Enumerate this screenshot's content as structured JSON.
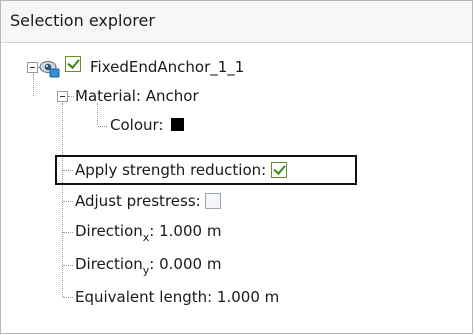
{
  "panel": {
    "title": "Selection explorer"
  },
  "tree": {
    "root": {
      "label": "FixedEndAnchor_1_1",
      "visible": true,
      "checked": true
    },
    "material": {
      "label": "Material: Anchor"
    },
    "colour": {
      "label": "Colour:",
      "value_hex": "#000000"
    },
    "apply_strength_reduction": {
      "label": "Apply strength reduction:",
      "checked": true
    },
    "adjust_prestress": {
      "label": "Adjust prestress:",
      "checked": false
    },
    "direction_x": {
      "prefix": "Direction",
      "sub": "x",
      "value": ": 1.000 m"
    },
    "direction_y": {
      "prefix": "Direction",
      "sub": "y",
      "value": ": 0.000 m"
    },
    "equivalent_length": {
      "label": "Equivalent length: 1.000 m"
    }
  }
}
